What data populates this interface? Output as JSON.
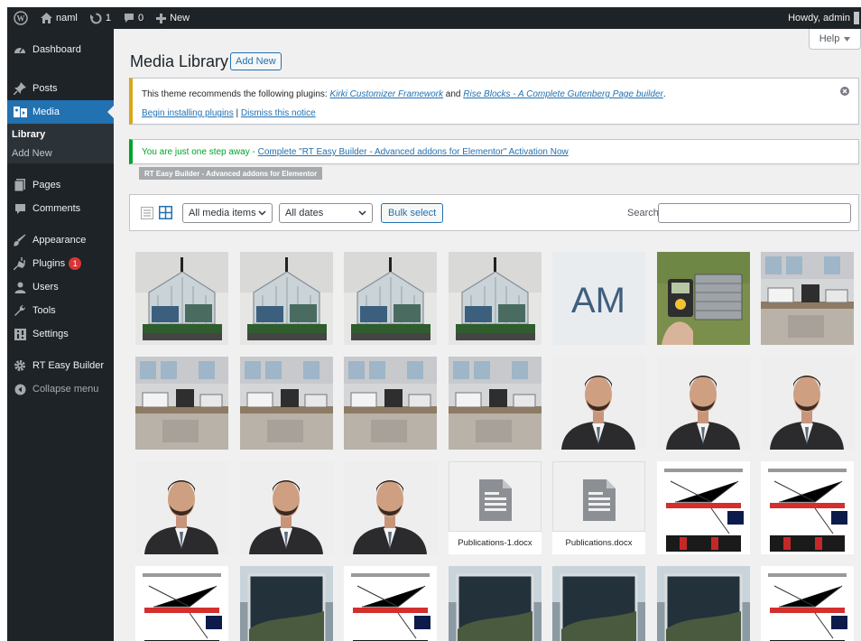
{
  "admin_bar": {
    "site_name": "naml",
    "updates_count": "1",
    "comments_count": "0",
    "new_label": "New",
    "greeting": "Howdy, admin"
  },
  "sidebar": {
    "items": [
      {
        "label": "Dashboard",
        "icon": "dashboard-icon"
      },
      {
        "label": "Posts",
        "icon": "pin-icon"
      },
      {
        "label": "Media",
        "icon": "media-icon"
      },
      {
        "label": "Pages",
        "icon": "page-icon"
      },
      {
        "label": "Comments",
        "icon": "comment-icon"
      },
      {
        "label": "Appearance",
        "icon": "brush-icon"
      },
      {
        "label": "Plugins",
        "icon": "plugin-icon",
        "badge": "1"
      },
      {
        "label": "Users",
        "icon": "user-icon"
      },
      {
        "label": "Tools",
        "icon": "wrench-icon"
      },
      {
        "label": "Settings",
        "icon": "settings-icon"
      },
      {
        "label": "RT Easy Builder",
        "icon": "gear-icon"
      },
      {
        "label": "Collapse menu",
        "icon": "collapse-icon"
      }
    ],
    "submenu": [
      "Library",
      "Add New"
    ]
  },
  "header": {
    "title": "Media Library",
    "add_new": "Add New",
    "help": "Help"
  },
  "notices": {
    "plugins": {
      "text_before": "This theme recommends the following plugins:",
      "plugin_1": "Kirki Customizer Framework",
      "and": "and",
      "plugin_2": "Rise Blocks - A Complete Gutenberg Page builder",
      "period": ".",
      "install_link": "Begin installing plugins",
      "separator": "|",
      "dismiss_link": "Dismiss this notice"
    },
    "activation": {
      "text_before": "You are just one step away -",
      "link": "Complete \"RT Easy Builder - Advanced addons for Elementor\" Activation Now",
      "tooltip": "RT Easy Builder - Advanced addons for Elementor"
    }
  },
  "toolbar": {
    "media_type": "All media items",
    "dates": "All dates",
    "bulk_select": "Bulk select",
    "search_label": "Search",
    "search_value": ""
  },
  "attachments": [
    {
      "kind": "greenhouse"
    },
    {
      "kind": "greenhouse"
    },
    {
      "kind": "greenhouse"
    },
    {
      "kind": "greenhouse"
    },
    {
      "kind": "logo",
      "text": "AM"
    },
    {
      "kind": "solar-panel"
    },
    {
      "kind": "lab"
    },
    {
      "kind": "lab"
    },
    {
      "kind": "lab"
    },
    {
      "kind": "lab"
    },
    {
      "kind": "lab"
    },
    {
      "kind": "portrait"
    },
    {
      "kind": "portrait"
    },
    {
      "kind": "portrait"
    },
    {
      "kind": "portrait"
    },
    {
      "kind": "portrait"
    },
    {
      "kind": "portrait"
    },
    {
      "kind": "document",
      "filename": "Publications-1.docx"
    },
    {
      "kind": "document",
      "filename": "Publications.docx"
    },
    {
      "kind": "diagram"
    },
    {
      "kind": "diagram"
    },
    {
      "kind": "diagram"
    },
    {
      "kind": "photo"
    },
    {
      "kind": "diagram"
    },
    {
      "kind": "photo"
    },
    {
      "kind": "photo"
    },
    {
      "kind": "photo"
    },
    {
      "kind": "diagram"
    }
  ],
  "colors": {
    "admin_dark": "#1d2327",
    "accent": "#2271b1",
    "warning": "#dba617",
    "success": "#00a32a",
    "badge": "#d63638"
  }
}
